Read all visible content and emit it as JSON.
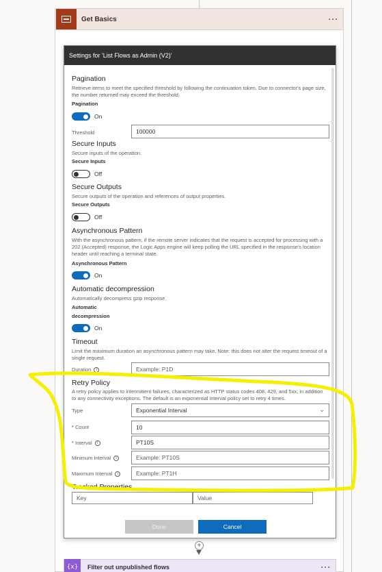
{
  "action": {
    "title": "Get Basics",
    "more": "···"
  },
  "dialog": {
    "title": "Settings for 'List Flows as Admin (V2)'",
    "pagination": {
      "title": "Pagination",
      "desc": "Retrieve items to meet the specified threshold by following the continuation token. Due to connector's page size, the number returned may exceed the threshold.",
      "label": "Pagination",
      "state": "On",
      "threshold_label": "Threshold",
      "threshold_value": "100000"
    },
    "secure_inputs": {
      "title": "Secure Inputs",
      "desc": "Secure inputs of the operation.",
      "label": "Secure Inputs",
      "state": "Off"
    },
    "secure_outputs": {
      "title": "Secure Outputs",
      "desc": "Secure outputs of the operation and references of output properties.",
      "label": "Secure Outputs",
      "state": "Off"
    },
    "async": {
      "title": "Asynchronous Pattern",
      "desc": "With the asynchronous pattern, if the remote server indicates that the request is accepted for processing with a 202 (Accepted) response, the Logic Apps engine will keep polling the URL specified in the response's location header until reaching a terminal state.",
      "label": "Asynchronous Pattern",
      "state": "On"
    },
    "decompression": {
      "title": "Automatic decompression",
      "desc": "Automatically decompress gzip response.",
      "label_line1": "Automatic",
      "label_line2": "decompression",
      "state": "On"
    },
    "timeout": {
      "title": "Timeout",
      "desc": "Limit the maximum duration an asynchronous pattern may take. Note: this does not alter the request timeout of a single request.",
      "duration_label": "Duration",
      "duration_placeholder": "Example: P1D"
    },
    "retry": {
      "title": "Retry Policy",
      "desc": "A retry policy applies to intermittent failures, characterized as HTTP status codes 408, 429, and 5xx, in addition to any connectivity exceptions. The default is an exponential interval policy set to retry 4 times.",
      "type_label": "Type",
      "type_value": "Exponential Interval",
      "count_label": "Count",
      "count_value": "10",
      "interval_label": "Interval",
      "interval_value": "PT10S",
      "min_label": "Minimum Interval",
      "min_placeholder": "Example: PT10S",
      "max_label": "Maximum Interval",
      "max_placeholder": "Example: PT1H"
    },
    "tracked": {
      "title": "Tracked Properties",
      "key_placeholder": "Key",
      "value_placeholder": "Value"
    },
    "buttons": {
      "done": "Done",
      "cancel": "Cancel"
    }
  },
  "next_action": {
    "icon": "{x}",
    "title": "Filter out unpublished flows",
    "more": "···"
  },
  "colors": {
    "accent": "#0f6cbd",
    "highlight": "#f5ef00",
    "action_icon": "#a33a1a",
    "next_icon": "#8b5cd6"
  }
}
